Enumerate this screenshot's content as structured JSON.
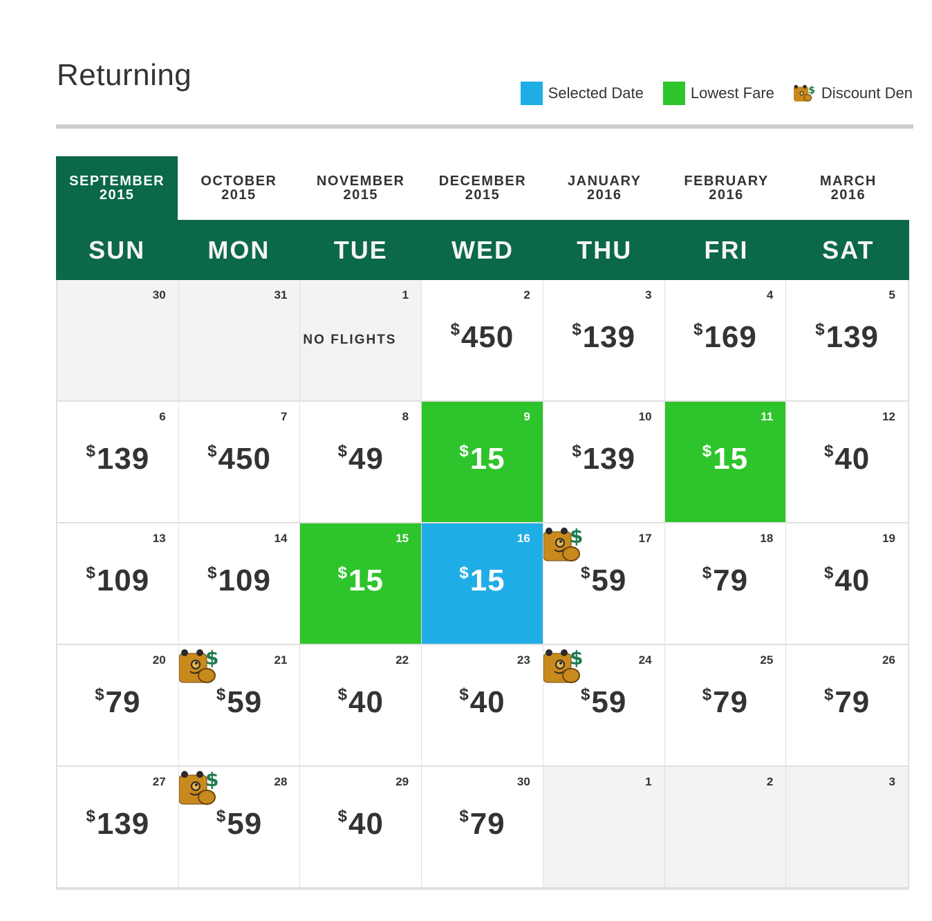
{
  "title": "Returning",
  "legend": [
    {
      "label": "Selected Date",
      "color": "#1fade6",
      "type": "swatch"
    },
    {
      "label": "Lowest Fare",
      "color": "#2ec42b",
      "type": "swatch"
    },
    {
      "label": "Discount Den",
      "type": "bear-icon"
    }
  ],
  "months": [
    {
      "month": "September",
      "year": "2015",
      "active": true
    },
    {
      "month": "October",
      "year": "2015",
      "active": false
    },
    {
      "month": "November",
      "year": "2015",
      "active": false
    },
    {
      "month": "December",
      "year": "2015",
      "active": false
    },
    {
      "month": "January",
      "year": "2016",
      "active": false
    },
    {
      "month": "February",
      "year": "2016",
      "active": false
    },
    {
      "month": "March",
      "year": "2016",
      "active": false
    }
  ],
  "weekdays": [
    "SUN",
    "MON",
    "TUE",
    "WED",
    "THU",
    "FRI",
    "SAT"
  ],
  "currency_symbol": "$",
  "no_flights_label": "NO FLIGHTS",
  "colors": {
    "brand_green": "#0b6848",
    "lowest_fare": "#2ec42b",
    "selected": "#1fade6",
    "muted": "#f3f3f3"
  },
  "days": [
    {
      "day": "30",
      "state": "muted"
    },
    {
      "day": "31",
      "state": "muted"
    },
    {
      "day": "1",
      "state": "muted",
      "no_flights": true
    },
    {
      "day": "2",
      "price": "450"
    },
    {
      "day": "3",
      "price": "139"
    },
    {
      "day": "4",
      "price": "169"
    },
    {
      "day": "5",
      "price": "139"
    },
    {
      "day": "6",
      "price": "139"
    },
    {
      "day": "7",
      "price": "450"
    },
    {
      "day": "8",
      "price": "49"
    },
    {
      "day": "9",
      "price": "15",
      "state": "lowest"
    },
    {
      "day": "10",
      "price": "139"
    },
    {
      "day": "11",
      "price": "15",
      "state": "lowest"
    },
    {
      "day": "12",
      "price": "40"
    },
    {
      "day": "13",
      "price": "109"
    },
    {
      "day": "14",
      "price": "109"
    },
    {
      "day": "15",
      "price": "15",
      "state": "lowest"
    },
    {
      "day": "16",
      "price": "15",
      "state": "selected"
    },
    {
      "day": "17",
      "price": "59",
      "discount_den": true
    },
    {
      "day": "18",
      "price": "79"
    },
    {
      "day": "19",
      "price": "40"
    },
    {
      "day": "20",
      "price": "79"
    },
    {
      "day": "21",
      "price": "59",
      "discount_den": true
    },
    {
      "day": "22",
      "price": "40"
    },
    {
      "day": "23",
      "price": "40"
    },
    {
      "day": "24",
      "price": "59",
      "discount_den": true
    },
    {
      "day": "25",
      "price": "79"
    },
    {
      "day": "26",
      "price": "79"
    },
    {
      "day": "27",
      "price": "139"
    },
    {
      "day": "28",
      "price": "59",
      "discount_den": true
    },
    {
      "day": "29",
      "price": "40"
    },
    {
      "day": "30",
      "price": "79"
    },
    {
      "day": "1",
      "state": "muted"
    },
    {
      "day": "2",
      "state": "muted"
    },
    {
      "day": "3",
      "state": "muted"
    }
  ]
}
